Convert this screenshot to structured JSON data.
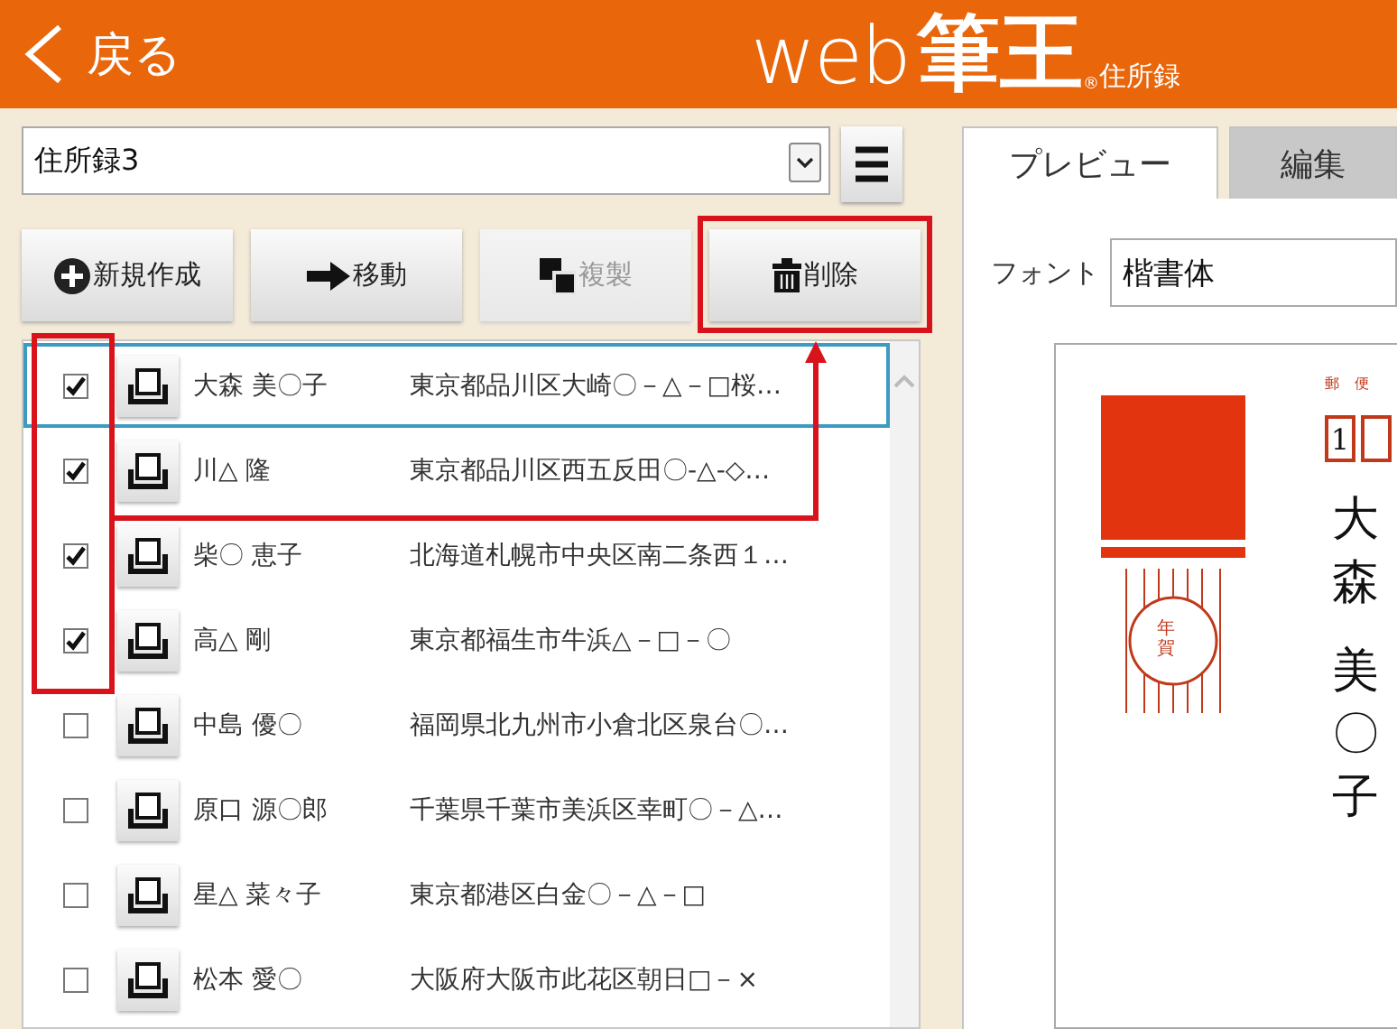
{
  "header": {
    "back": {
      "label": "戻る"
    },
    "logo": {
      "web": "web",
      "brand": "筆王",
      "registered": "®",
      "sub": "住所録"
    }
  },
  "address_book": {
    "select": "住所録3"
  },
  "toolbar": [
    {
      "kind": "new",
      "label": "新規作成",
      "disabled": false
    },
    {
      "kind": "move",
      "label": "移動",
      "disabled": false
    },
    {
      "kind": "copy",
      "label": "複製",
      "disabled": true
    },
    {
      "kind": "delete",
      "label": "削除",
      "disabled": false
    }
  ],
  "contacts": [
    {
      "name": "大森 美〇子",
      "address": "東京都品川区大崎〇－△－□桜…",
      "checked": true,
      "selected": true
    },
    {
      "name": "川△ 隆",
      "address": "東京都品川区西五反田〇-△-◇…",
      "checked": true,
      "selected": false
    },
    {
      "name": "柴〇 恵子",
      "address": "北海道札幌市中央区南二条西１…",
      "checked": true,
      "selected": false
    },
    {
      "name": "高△ 剛",
      "address": "東京都福生市牛浜△－□－〇",
      "checked": true,
      "selected": false
    },
    {
      "name": "中島 優〇",
      "address": "福岡県北九州市小倉北区泉台〇…",
      "checked": false,
      "selected": false
    },
    {
      "name": "原口 源〇郎",
      "address": "千葉県千葉市美浜区幸町〇－△…",
      "checked": false,
      "selected": false
    },
    {
      "name": "星△ 菜々子",
      "address": "東京都港区白金〇－△－□",
      "checked": false,
      "selected": false
    },
    {
      "name": "松本 愛〇",
      "address": "大阪府大阪市此花区朝日□－×",
      "checked": false,
      "selected": false
    }
  ],
  "tabs": [
    {
      "label": "プレビュー",
      "selected": true
    },
    {
      "label": "編集",
      "selected": false
    }
  ],
  "font": {
    "label": "フォント",
    "value": "楷書体"
  },
  "postcard": {
    "postal_label": "郵 便",
    "postcode": [
      "1"
    ],
    "stamp_text": "年賀",
    "recipient": [
      "大森",
      "美〇子"
    ]
  }
}
